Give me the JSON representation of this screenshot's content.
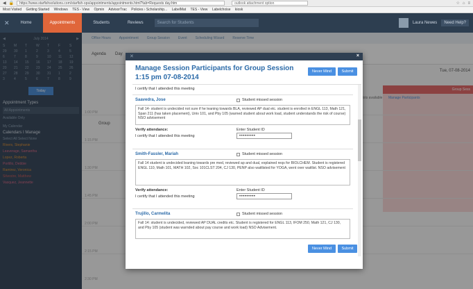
{
  "browser": {
    "url": "https://www.starfishsolutions.com/starfish-ops/appointments/appointments.html?tab=Requests day.htm",
    "search_query": "outlook attachment option"
  },
  "bookmarks": [
    "Most Visited",
    "Getting Started",
    "Windows",
    "TES - View",
    "Opmin",
    "AdvisorTrac",
    "Policies › Scholarship...",
    "LabelMat",
    "TES - View",
    "Labelchoise",
    "kiosk"
  ],
  "app_nav": {
    "tabs": [
      "Home",
      "Appointments",
      "Students",
      "Reviews"
    ],
    "search_placeholder": "Search for Students",
    "user": "Laura Newes",
    "help": "Need Help?"
  },
  "sidebar": {
    "month": "July 2014",
    "day_headers": [
      "S",
      "M",
      "T",
      "W",
      "T",
      "F",
      "S"
    ],
    "weeks": [
      [
        "29",
        "30",
        "1",
        "2",
        "3",
        "4",
        "5"
      ],
      [
        "6",
        "7",
        "8",
        "9",
        "10",
        "11",
        "12"
      ],
      [
        "13",
        "14",
        "15",
        "16",
        "17",
        "18",
        "19"
      ],
      [
        "20",
        "21",
        "22",
        "23",
        "24",
        "25",
        "26"
      ],
      [
        "27",
        "28",
        "29",
        "30",
        "31",
        "1",
        "2"
      ],
      [
        "3",
        "4",
        "5",
        "6",
        "7",
        "8",
        "9"
      ]
    ],
    "today_label": "Today",
    "types_title": "Appointment Types",
    "types_select": "All Appointments",
    "available_only": "Available Only",
    "my_calendar": "My Calendar",
    "calendars_title": "Calendars I Manage",
    "select_all": "Select All",
    "select_none": "Select None",
    "calendars": [
      "Rivers, Stephanie",
      "Leaverage, Samantha",
      "Lopez, Roberta",
      "Portillo, Debbie",
      "Ramirez, Veronica",
      "Silvestre, Matthew",
      "Vasquez, Jeannette"
    ]
  },
  "main": {
    "toolbar": [
      "Office Hours",
      "Appointment",
      "Group Session",
      "Event",
      "Scheduling Wizard",
      "Reserve Time"
    ],
    "agenda": "Agenda",
    "day": "Day",
    "date": "Tue, 07-08-2014",
    "group_label": "Group",
    "busy_label": "Group Sess",
    "slots_text": "slots available",
    "manage_link": "Manage Participants",
    "times": [
      "1:00 PM",
      "1:15 PM",
      "1:30 PM",
      "1:45 PM",
      "2:00 PM",
      "2:15 PM",
      "2:30 PM"
    ]
  },
  "modal": {
    "title": "Manage Session Participants for Group Session 1:15 pm 07-08-2014",
    "never_mind": "Never Mind",
    "submit": "Submit",
    "certify_top": "I certify that I attended this meeting",
    "participants": [
      {
        "name": "Saavedra, Jose",
        "missed": "Student missed session",
        "note": "Fall 14- student is undecided not sure if he leaning towards BLA, reviewed AP dual etc. student is enrolled in ENGL 113, Math 121, Span 211 (has taken placement), Univ 101, and Pby 105 (warned student about work load, student understands the risk of course) NSO advisement",
        "verify": "Verify attendance:",
        "enter_id": "Enter Student ID",
        "certify": "I certify that I attended this meeting",
        "id_value": "•••••••••"
      },
      {
        "name": "Smith-Fassler, Mariah",
        "missed": "Student missed session",
        "note": "Fall 14 student is undecided leaning towards pre med, reviewed ap and dual, explained reqs for BIOLCHEM. Student is registered ENGL 110, Math 101, MATH 102, Soc 101CLST 204, CJ 130, PENP also waitlisted for YOGA, went over waitlist. NSO advisement",
        "verify": "Verify attendance:",
        "enter_id": "Enter Student ID",
        "certify": "I certify that I attended this meeting",
        "id_value": "•••••••••"
      },
      {
        "name": "Trujillo, Carmelita",
        "missed": "Student missed session",
        "note": "Fall 14: student is undecided, reviewed AP DUAL credits etc. Student is registered for ENGL 113, IFOM 250, Math 121, CJ 130, and Pby 105 (student was warnded about pay course and work load) NSO Advisement.",
        "verify": "",
        "enter_id": "",
        "certify": "",
        "id_value": ""
      }
    ]
  }
}
